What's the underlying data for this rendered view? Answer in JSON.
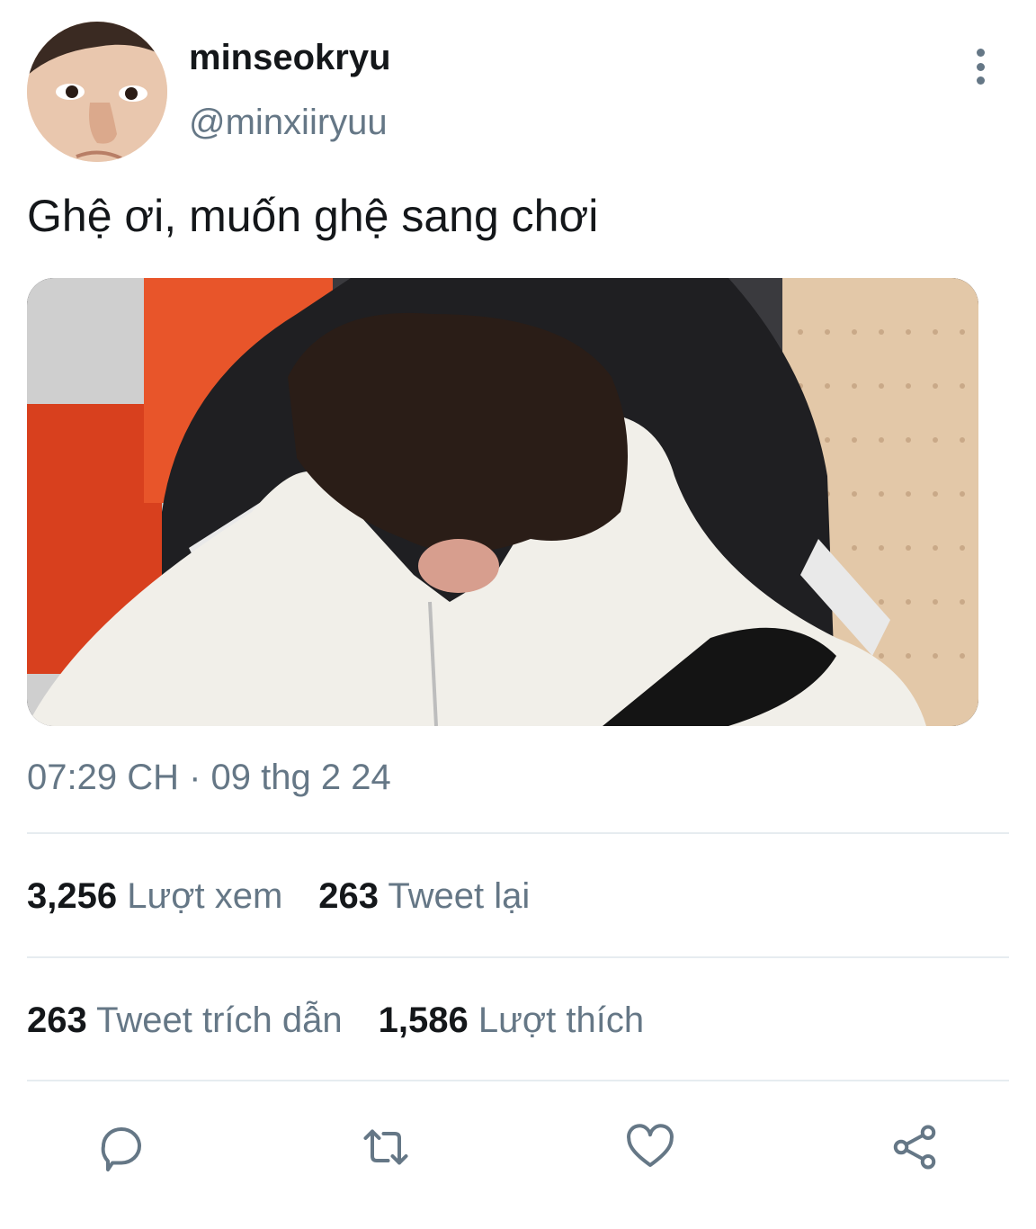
{
  "tweet": {
    "display_name": "minseokryu",
    "handle": "@minxiiryuu",
    "text": "Ghệ ơi, muốn ghệ sang chơi",
    "timestamp": "07:29 CH · 09 thg 2 24"
  },
  "stats": {
    "views_count": "3,256",
    "views_label": "Lượt xem",
    "retweets_count": "263",
    "retweets_label": "Tweet lại",
    "quotes_count": "263",
    "quotes_label": "Tweet trích dẫn",
    "likes_count": "1,586",
    "likes_label": "Lượt thích"
  },
  "icons": {
    "more": "more-vertical-icon",
    "reply": "reply-icon",
    "retweet": "retweet-icon",
    "like": "heart-icon",
    "share": "share-icon"
  },
  "colors": {
    "text_primary": "#14171a",
    "text_secondary": "#657786",
    "divider": "#e6ecf0"
  }
}
